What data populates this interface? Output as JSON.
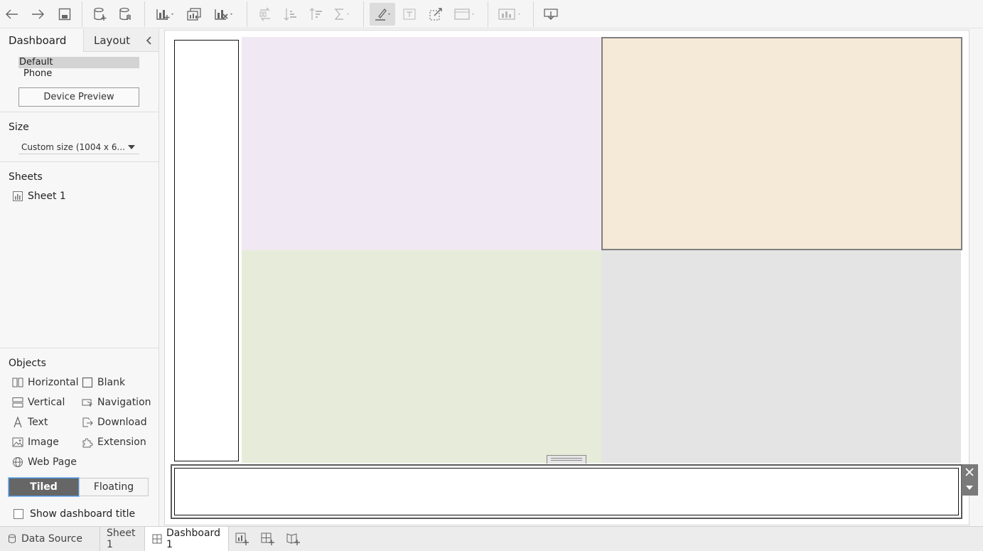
{
  "toolbar": {
    "icons": [
      "undo-icon",
      "redo-icon",
      "save-icon",
      "new-data-source-icon",
      "pause-updates-icon",
      "new-worksheet-icon",
      "duplicate-icon",
      "clear-icon",
      "swap-icon",
      "sort-ascending-icon",
      "sort-descending-icon",
      "totals-icon",
      "highlight-icon",
      "labels-icon",
      "fix-axes-icon",
      "fit-icon",
      "show-me-icon",
      "present-icon"
    ]
  },
  "panel": {
    "tabs": {
      "dashboard": "Dashboard",
      "layout": "Layout"
    },
    "device": {
      "default": "Default",
      "phone": "Phone",
      "preview_button": "Device Preview"
    },
    "size": {
      "heading": "Size",
      "value": "Custom size (1004 x 6..."
    },
    "sheets": {
      "heading": "Sheets",
      "items": [
        {
          "label": "Sheet 1",
          "icon": "worksheet-icon"
        }
      ]
    },
    "objects": {
      "heading": "Objects",
      "items": [
        {
          "label": "Horizontal",
          "icon": "horizontal-container-icon"
        },
        {
          "label": "Blank",
          "icon": "blank-icon"
        },
        {
          "label": "Vertical",
          "icon": "vertical-container-icon"
        },
        {
          "label": "Navigation",
          "icon": "navigation-icon"
        },
        {
          "label": "Text",
          "icon": "text-icon"
        },
        {
          "label": "Download",
          "icon": "download-icon"
        },
        {
          "label": "Image",
          "icon": "image-icon"
        },
        {
          "label": "Extension",
          "icon": "extension-icon"
        },
        {
          "label": "Web Page",
          "icon": "web-page-icon"
        }
      ]
    },
    "layout_mode": {
      "tiled": "Tiled",
      "floating": "Floating",
      "selected": "Tiled"
    },
    "show_title": {
      "label": "Show dashboard title",
      "checked": false
    }
  },
  "canvas": {
    "colors": {
      "top_left": "#f0e8f2",
      "top_right": "#f5e9d8",
      "bottom_left": "#e6ecd9",
      "bottom_right": "#e4e4e4",
      "selection_border": "#7f7f7f"
    }
  },
  "bottom_tabs": {
    "data_source": "Data Source",
    "sheet1": "Sheet 1",
    "dashboard1": "Dashboard 1",
    "active": "Dashboard 1"
  }
}
